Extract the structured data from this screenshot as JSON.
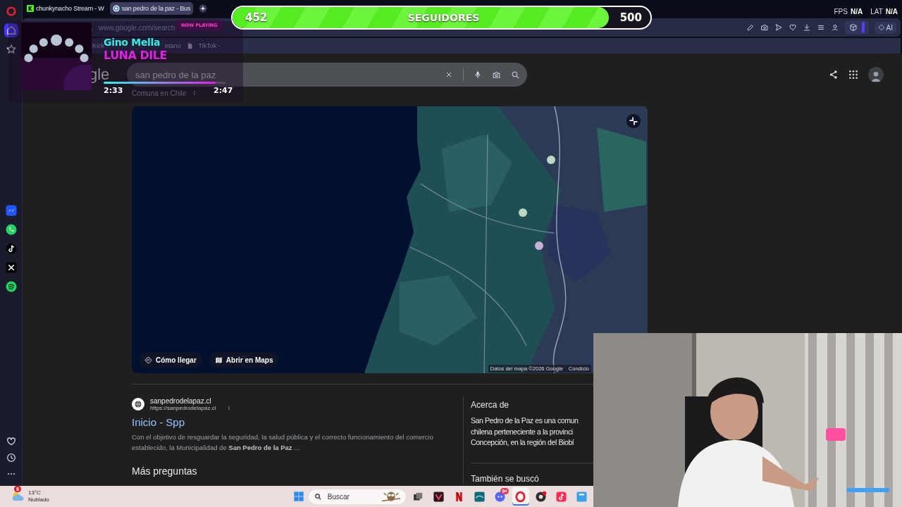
{
  "sidebar": {
    "items": [
      {
        "kind": "logo",
        "selected": false
      },
      {
        "kind": "home",
        "selected": true
      },
      {
        "kind": "star",
        "selected": false
      },
      {
        "kind": "messenger",
        "selected": false
      },
      {
        "kind": "whatsapp",
        "selected": false
      },
      {
        "kind": "tiktok",
        "selected": false
      },
      {
        "kind": "x",
        "selected": false
      },
      {
        "kind": "spotify",
        "selected": false
      },
      {
        "kind": "heart",
        "selected": false
      },
      {
        "kind": "clock",
        "selected": false
      },
      {
        "kind": "more",
        "selected": false
      }
    ]
  },
  "browser_tabs": [
    {
      "title": "chunkynacho Stream - W",
      "selected": false
    },
    {
      "title": "san pedro de la paz - Bus",
      "selected": true
    }
  ],
  "address_bar": {
    "url": "www.google.com/search"
  },
  "toolbar": {
    "ai_label": "AI"
  },
  "bookmarks": [
    "Kick",
    "etano",
    "TikTok -"
  ],
  "google": {
    "logo_fragment": "gle",
    "search": {
      "value": "san pedro de la paz"
    },
    "subtitle": "Comuna en Chile",
    "map": {
      "kind": "picture",
      "buttons": [
        "Cómo llegar",
        "Abrir en Maps"
      ],
      "attribution": "Datos del mapa ©2026 Google",
      "terms": "Condicio"
    },
    "result": {
      "site_name": "sanpedrodelapaz.cl",
      "url": "https://sanpedrodelapaz.cl",
      "title": "Inicio - Spp",
      "snippet": "Con el objetivo de resguardar la seguridad, la salud pública y el correcto funcionamiento del comercio establecido, la Municipalidad de **San Pedro de la Paz** ..."
    },
    "more_questions": "Más preguntas",
    "about": {
      "heading": "Acerca de",
      "lines": [
        "San Pedro de la Paz es una comun",
        "chilena perteneciente a la provinci",
        "Concepción, en la región del Biobí"
      ]
    },
    "also_searched": "También se buscó"
  },
  "stream_overlay": {
    "followers": {
      "current": "452",
      "label": "SEGUIDORES",
      "goal": "500",
      "level": 0.9
    },
    "now_playing": {
      "badge": "NOW PLAYING",
      "artist": "Gino Mella",
      "song": "LUNA DILE",
      "elapsed": "2:33",
      "duration": "2:47",
      "level": 0.92
    },
    "stats": [
      {
        "label": "FPS",
        "value": "N/A"
      },
      {
        "label": "LAT",
        "value": "N/A"
      }
    ]
  },
  "taskbar": {
    "weather": {
      "temperature": "13°C",
      "condition": "Nublado",
      "badge": "8"
    },
    "search": {
      "placeholder": "Buscar"
    },
    "apps": [
      {
        "kind": "squares",
        "selected": false
      },
      {
        "kind": "vee",
        "selected": false
      },
      {
        "kind": "en",
        "selected": false
      },
      {
        "kind": "tile",
        "selected": false
      },
      {
        "kind": "bubble",
        "selected": false,
        "badge": "9+"
      },
      {
        "kind": "ring",
        "selected": true
      },
      {
        "kind": "disc",
        "selected": false
      },
      {
        "kind": "note",
        "selected": false
      },
      {
        "kind": "panel",
        "selected": false
      }
    ]
  }
}
